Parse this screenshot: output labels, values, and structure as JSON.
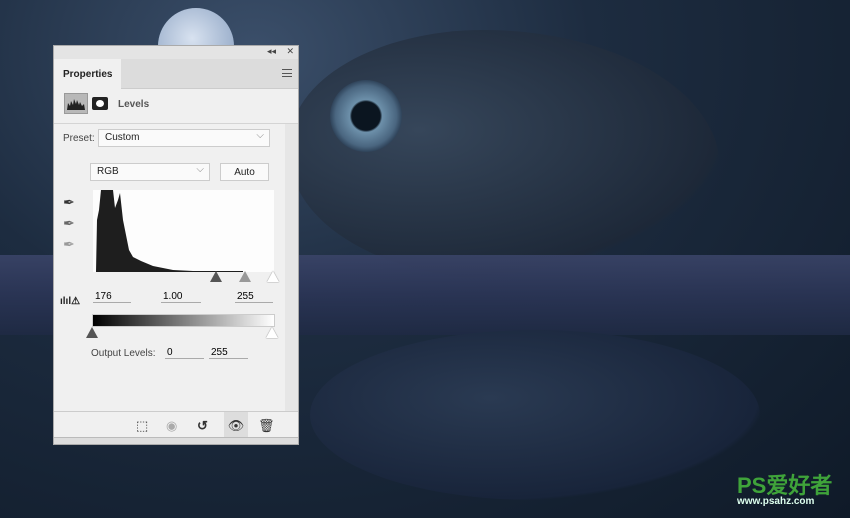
{
  "panel": {
    "tab_label": "Properties",
    "adjustment_title": "Levels",
    "preset_label": "Preset:",
    "preset_value": "Custom",
    "channel_value": "RGB",
    "auto_label": "Auto",
    "input_levels": {
      "black": "176",
      "gamma": "1.00",
      "white": "255"
    },
    "output_label": "Output Levels:",
    "output_levels": {
      "black": "0",
      "white": "255"
    },
    "collapse_glyph": "◂◂",
    "close_glyph": "✕"
  },
  "icons": [
    "levels-icon",
    "mask-icon",
    "panel-menu-icon",
    "black-eyedropper-icon",
    "gray-eyedropper-icon",
    "white-eyedropper-icon",
    "clipping-warning-icon",
    "clip-to-layer-icon",
    "view-previous-icon",
    "reset-icon",
    "visibility-icon",
    "trash-icon"
  ],
  "watermark": {
    "logo": "PS爱好者",
    "url": "www.psahz.com"
  },
  "colors": {
    "panel_bg": "#f0f0f0",
    "watermark": "#3fa33a"
  }
}
